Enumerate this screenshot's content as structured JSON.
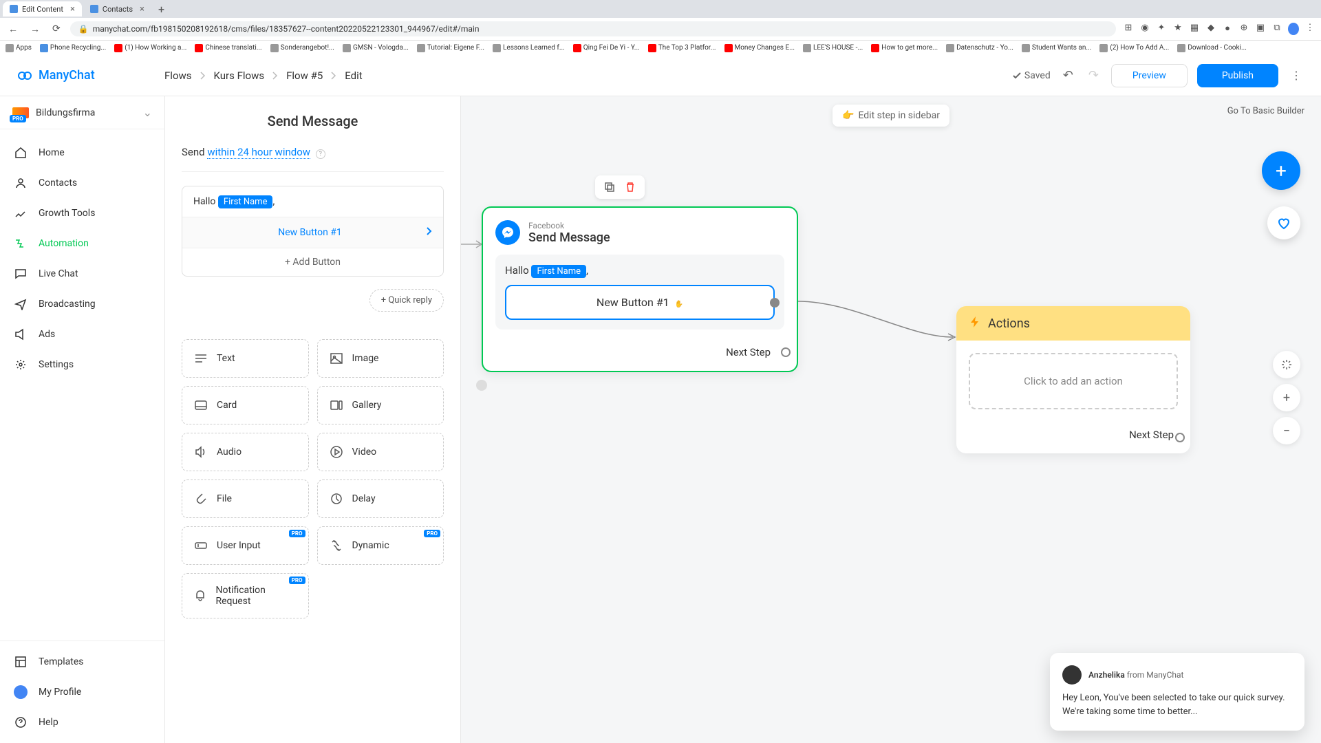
{
  "browser": {
    "tabs": [
      {
        "title": "Edit Content",
        "active": true
      },
      {
        "title": "Contacts",
        "active": false
      }
    ],
    "url": "manychat.com/fb198150208192618/cms/files/18357627--content20220522123301_944967/edit#/main",
    "bookmarks": [
      "Apps",
      "Phone Recycling...",
      "(1) How Working a...",
      "Chinese translati...",
      "Sonderangebot!...",
      "GMSN - Vologda...",
      "Tutorial: Eigene F...",
      "Lessons Learned f...",
      "Qing Fei De Yi - Y...",
      "The Top 3 Platfor...",
      "Money Changes E...",
      "LEE'S HOUSE -...",
      "How to get more...",
      "Datenschutz - Yo...",
      "Student Wants an...",
      "(2) How To Add A...",
      "Download - Cooki..."
    ]
  },
  "header": {
    "logo": "ManyChat",
    "breadcrumb": [
      "Flows",
      "Kurs Flows",
      "Flow #5",
      "Edit"
    ],
    "saved": "Saved",
    "preview": "Preview",
    "publish": "Publish"
  },
  "sidebar": {
    "workspace": "Bildungsfirma",
    "pro": "PRO",
    "nav": [
      {
        "label": "Home",
        "icon": "home"
      },
      {
        "label": "Contacts",
        "icon": "contacts"
      },
      {
        "label": "Growth Tools",
        "icon": "growth"
      },
      {
        "label": "Automation",
        "icon": "automation",
        "active": true
      },
      {
        "label": "Live Chat",
        "icon": "chat"
      },
      {
        "label": "Broadcasting",
        "icon": "broadcast"
      },
      {
        "label": "Ads",
        "icon": "ads"
      },
      {
        "label": "Settings",
        "icon": "settings"
      }
    ],
    "bottom": [
      {
        "label": "Templates",
        "icon": "templates"
      },
      {
        "label": "My Profile",
        "icon": "profile"
      },
      {
        "label": "Help",
        "icon": "help"
      }
    ]
  },
  "editor": {
    "title": "Send Message",
    "send_prefix": "Send",
    "send_window": "within 24 hour window",
    "msg_greeting": "Hallo",
    "msg_var": "First Name",
    "msg_comma": ",",
    "button_label": "New Button #1",
    "add_button": "+ Add Button",
    "quick_reply": "+ Quick reply",
    "tiles": [
      {
        "label": "Text",
        "icon": "text"
      },
      {
        "label": "Image",
        "icon": "image"
      },
      {
        "label": "Card",
        "icon": "card"
      },
      {
        "label": "Gallery",
        "icon": "gallery"
      },
      {
        "label": "Audio",
        "icon": "audio"
      },
      {
        "label": "Video",
        "icon": "video"
      },
      {
        "label": "File",
        "icon": "file"
      },
      {
        "label": "Delay",
        "icon": "delay"
      },
      {
        "label": "User Input",
        "icon": "input",
        "pro": true
      },
      {
        "label": "Dynamic",
        "icon": "dynamic",
        "pro": true
      },
      {
        "label": "Notification Request",
        "icon": "notification",
        "pro": true
      }
    ]
  },
  "canvas": {
    "edit_sidebar": "Edit step in sidebar",
    "basic_builder": "Go To Basic Builder",
    "node_send": {
      "platform": "Facebook",
      "title": "Send Message",
      "greeting": "Hallo",
      "var": "First Name",
      "button": "New Button #1",
      "next": "Next Step"
    },
    "node_actions": {
      "title": "Actions",
      "placeholder": "Click to add an action",
      "next": "Next Step"
    }
  },
  "chat": {
    "sender": "Anzhelika",
    "from": "from ManyChat",
    "body": "Hey Leon,  You've been selected to take our quick survey. We're taking some time to better..."
  }
}
